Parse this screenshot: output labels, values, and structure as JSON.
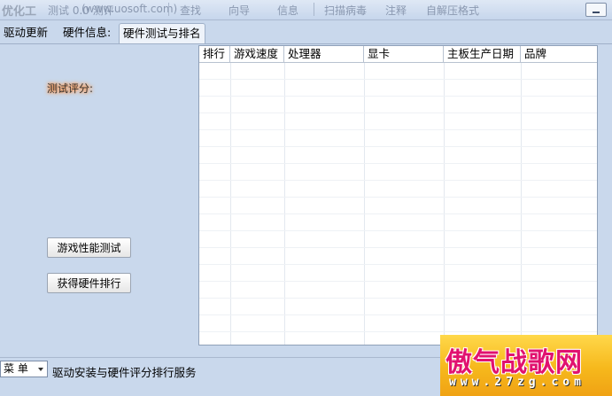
{
  "titlebar": {
    "app_title": "优化工",
    "faded_items": [
      "测试 0.0 测评",
      "(www.uosoft.com)",
      "查找",
      "向导",
      "信息",
      "扫描病毒",
      "注释",
      "自解压格式"
    ]
  },
  "tabs": [
    {
      "label": "驱动更新"
    },
    {
      "label": "硬件信息:"
    },
    {
      "label": "硬件测试与排名"
    }
  ],
  "score_label": "测试评分:",
  "buttons": {
    "game_test": "游戏性能测试",
    "get_rank": "获得硬件排行"
  },
  "table": {
    "columns": [
      "排行",
      "游戏速度",
      "处理器",
      "显卡",
      "主板生产日期",
      "品牌"
    ],
    "rows": []
  },
  "bottom": {
    "menu_label": "菜 单",
    "status_text": "驱动安装与硬件评分排行服务"
  },
  "watermark": {
    "main": "傲气战歌网",
    "sub": "www.27zg.com"
  }
}
